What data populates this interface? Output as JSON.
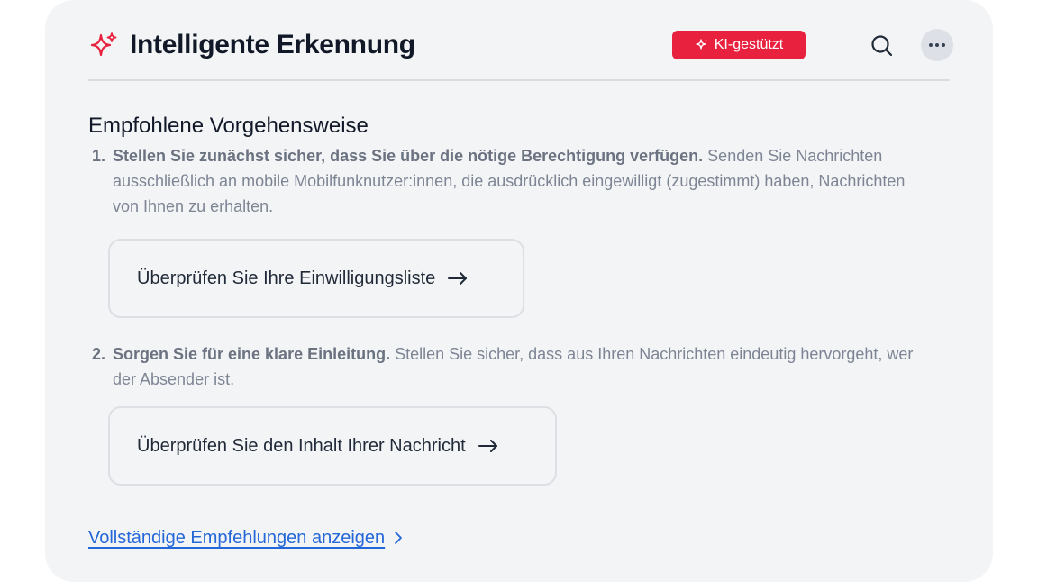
{
  "header": {
    "title": "Intelligente Erkennung",
    "badge_label": "KI-gestützt",
    "sparkle_icon": "sparkle-icon",
    "search_icon": "search-icon",
    "more_icon": "more-horizontal-icon"
  },
  "recommendations": {
    "heading": "Empfohlene Vorgehensweise",
    "steps": [
      {
        "number": "1.",
        "bold": "Stellen Sie zunächst sicher, dass Sie über die nötige Berechtigung verfügen.",
        "text": " Senden Sie Nachrichten ausschließlich an mobile Mobilfunknutzer:innen, die ausdrücklich eingewilligt (zugestimmt) haben, Nachrichten von Ihnen zu erhalten.",
        "action_label": "Überprüfen Sie Ihre Einwilligungsliste"
      },
      {
        "number": "2.",
        "bold": "Sorgen Sie für eine klare Einleitung.",
        "text": " Stellen Sie sicher, dass aus Ihren Nachrichten eindeutig hervorgeht, wer der Absender ist.",
        "action_label": "Überprüfen Sie den Inhalt Ihrer Nachricht"
      }
    ]
  },
  "footer": {
    "link_label": "Vollständige Empfehlungen anzeigen"
  },
  "colors": {
    "accent": "#e8213f",
    "link": "#2367d8",
    "card_background": "#f3f4f6"
  }
}
